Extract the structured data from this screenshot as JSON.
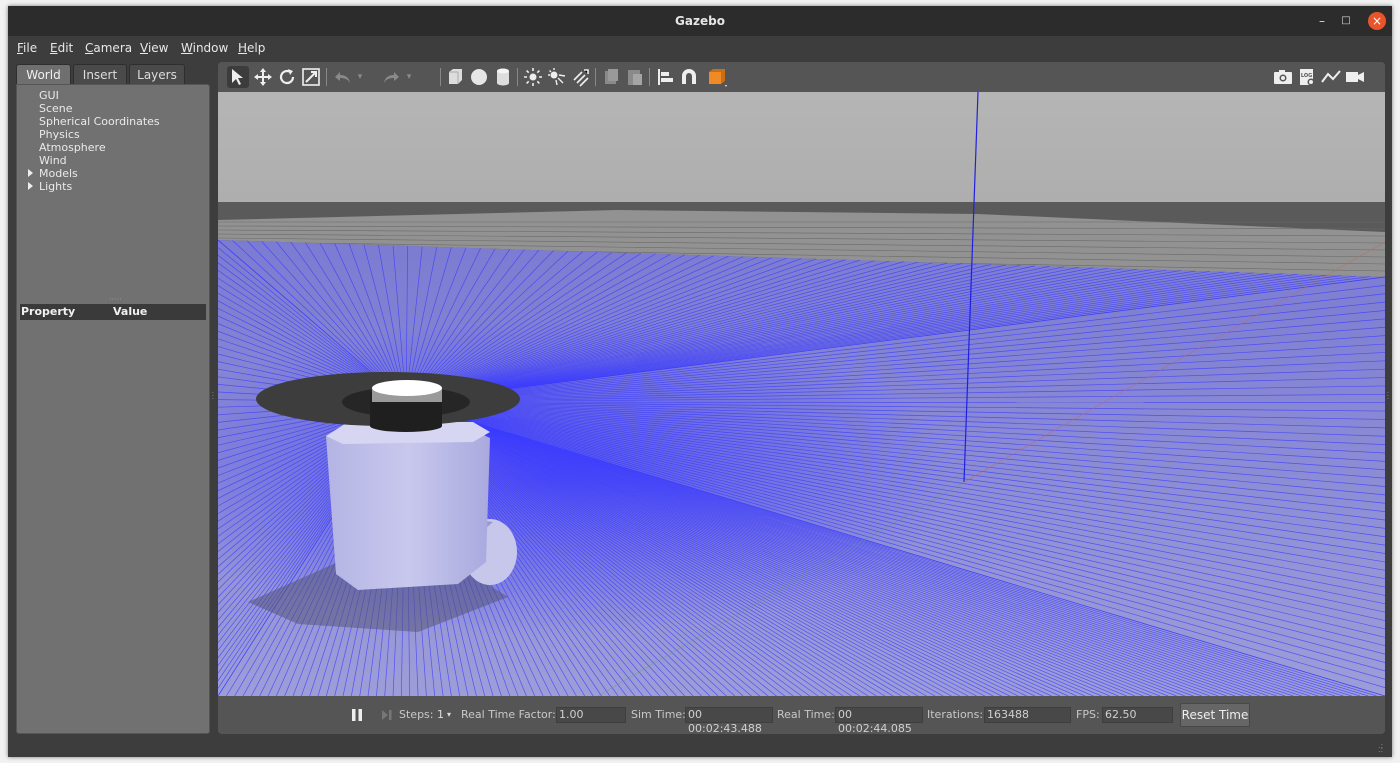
{
  "window": {
    "title": "Gazebo",
    "minimize_glyph": "–",
    "maximize_glyph": "□",
    "close_glyph": "×"
  },
  "menubar": {
    "items": [
      {
        "label": "File",
        "mnemonic": "F",
        "rest": "ile"
      },
      {
        "label": "Edit",
        "mnemonic": "E",
        "rest": "dit"
      },
      {
        "label": "Camera",
        "mnemonic": "C",
        "rest": "amera"
      },
      {
        "label": "View",
        "mnemonic": "V",
        "rest": "iew"
      },
      {
        "label": "Window",
        "mnemonic": "W",
        "rest": "indow"
      },
      {
        "label": "Help",
        "mnemonic": "H",
        "rest": "elp"
      }
    ]
  },
  "left_panel": {
    "tabs": [
      {
        "label": "World",
        "active": true
      },
      {
        "label": "Insert",
        "active": false
      },
      {
        "label": "Layers",
        "active": false
      }
    ],
    "tree": [
      {
        "label": "GUI",
        "expandable": false
      },
      {
        "label": "Scene",
        "expandable": false
      },
      {
        "label": "Spherical Coordinates",
        "expandable": false
      },
      {
        "label": "Physics",
        "expandable": false
      },
      {
        "label": "Atmosphere",
        "expandable": false
      },
      {
        "label": "Wind",
        "expandable": false
      },
      {
        "label": "Models",
        "expandable": true
      },
      {
        "label": "Lights",
        "expandable": true
      }
    ],
    "property_header": {
      "property": "Property",
      "value": "Value"
    }
  },
  "toolbar": {
    "left_icons": [
      "select-arrow-icon",
      "translate-icon",
      "rotate-icon",
      "scale-icon",
      "undo-icon",
      "redo-icon",
      "box-shape-icon",
      "sphere-shape-icon",
      "cylinder-shape-icon",
      "point-light-icon",
      "spot-light-icon",
      "directional-light-icon",
      "copy-icon",
      "paste-icon",
      "align-icon",
      "snap-icon",
      "view-angle-icon"
    ],
    "right_icons": [
      "screenshot-icon",
      "log-icon",
      "plot-icon",
      "record-video-icon"
    ],
    "log_badge": "LOG",
    "accent_color": "#f08a24"
  },
  "bottom_bar": {
    "steps_label": "Steps:",
    "steps_value": "1",
    "rtf_label": "Real Time Factor:",
    "rtf_value": "1.00",
    "sim_time_label": "Sim Time:",
    "sim_time_value": "00 00:02:43.488",
    "real_time_label": "Real Time:",
    "real_time_value": "00 00:02:44.085",
    "iterations_label": "Iterations:",
    "iterations_value": "163488",
    "fps_label": "FPS:",
    "fps_value": "62.50",
    "reset_label": "Reset Time"
  },
  "scene": {
    "laser_color": "#3a3aff",
    "sky_color": "#b3b3b3",
    "ground_color": "#8f8f8f"
  }
}
